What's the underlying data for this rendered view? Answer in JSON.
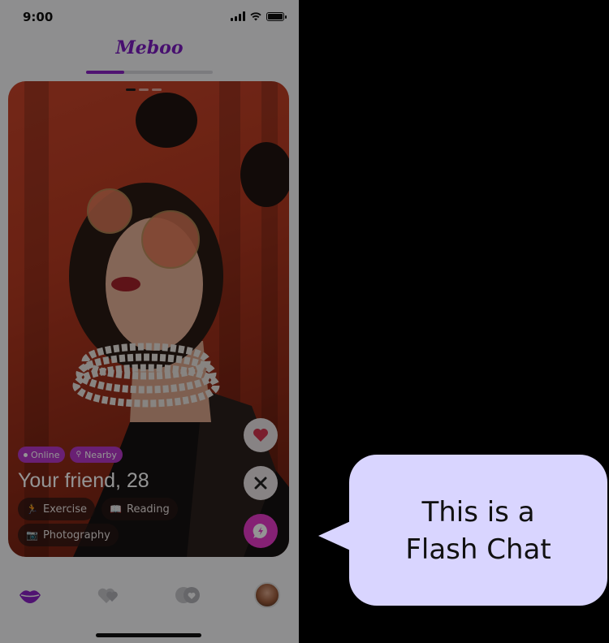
{
  "status_bar": {
    "time": "9:00"
  },
  "app": {
    "title": "Meboo",
    "progress": 0.3
  },
  "card": {
    "photo_index": 1,
    "photo_count": 3,
    "tags": [
      {
        "label": "Online",
        "icon": "dot-icon"
      },
      {
        "label": "Nearby",
        "icon": "location-icon"
      }
    ],
    "name": "Your friend, 28",
    "interests": [
      {
        "label": "Exercise",
        "icon": "running-icon"
      },
      {
        "label": "Reading",
        "icon": "book-icon"
      },
      {
        "label": "Photography",
        "icon": "camera-icon"
      }
    ]
  },
  "actions": [
    "heart-icon",
    "close-icon",
    "flash-chat-icon"
  ],
  "tabs": [
    "lips-icon",
    "hearts-icon",
    "match-icon",
    "avatar"
  ],
  "colors": {
    "brand": "#7a1bbf",
    "accent": "#e63ac9",
    "bubble": "#d9d5ff"
  },
  "tooltip": {
    "line1": "This is a",
    "line2": "Flash Chat"
  }
}
